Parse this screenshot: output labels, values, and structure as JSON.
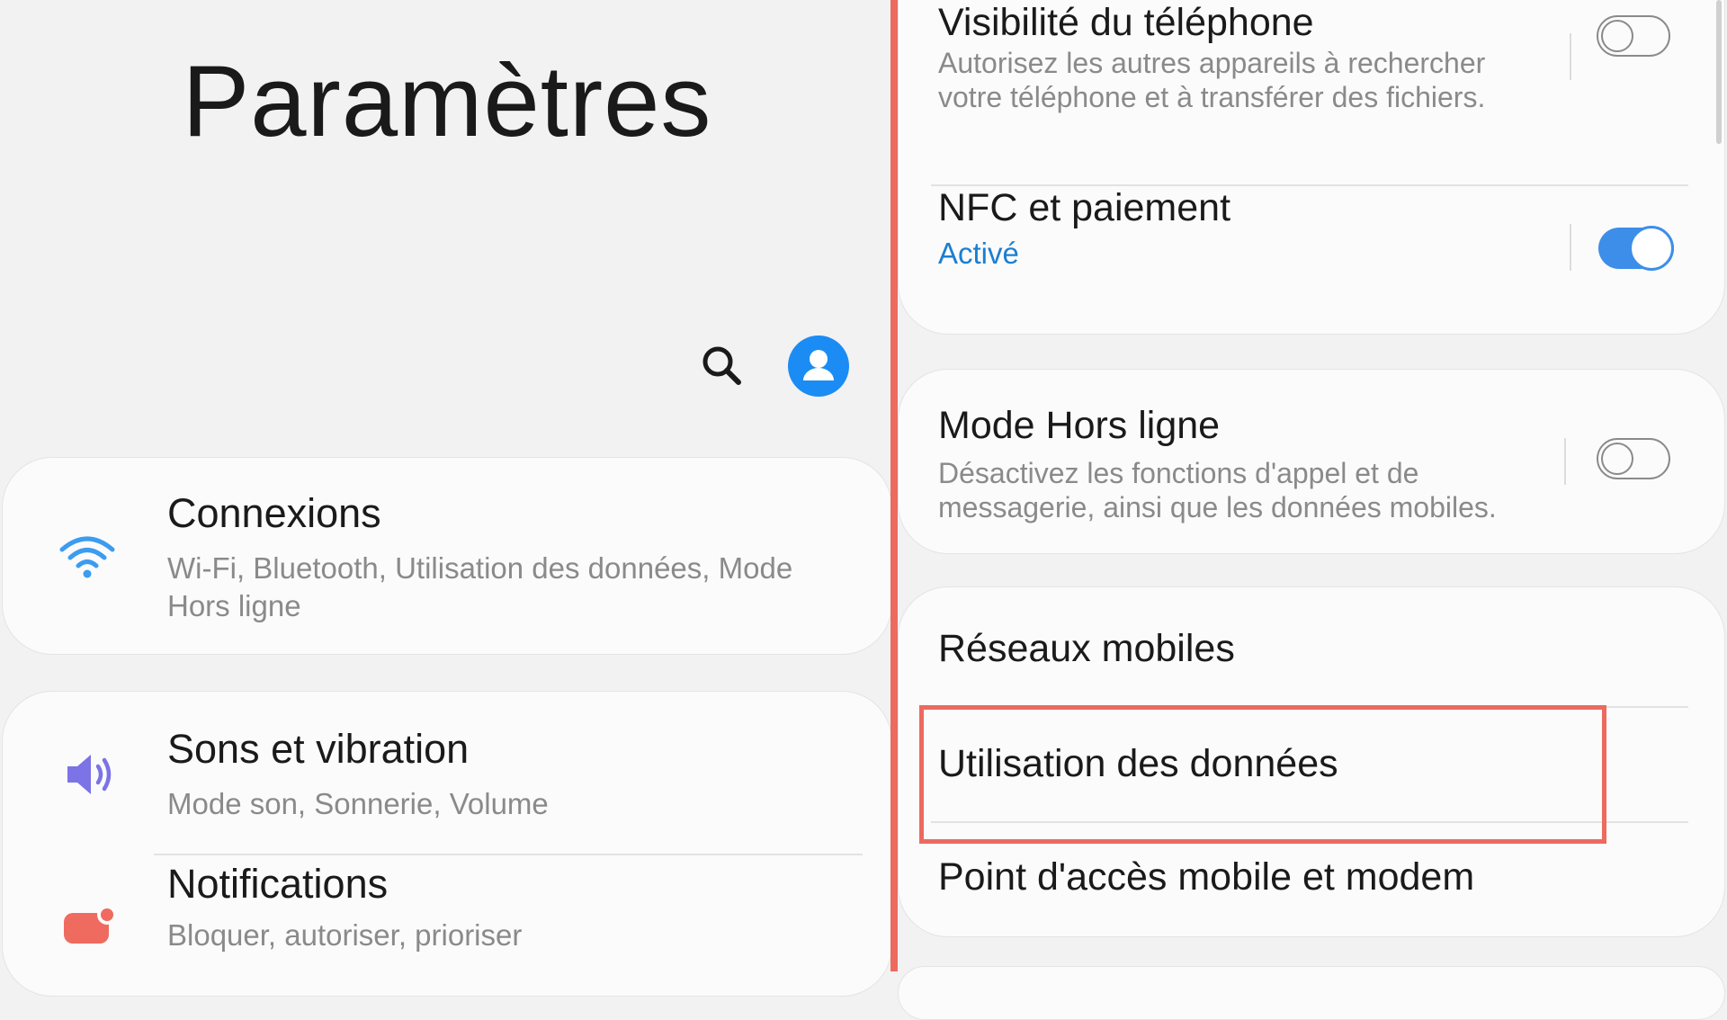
{
  "left": {
    "title": "Paramètres",
    "items": [
      {
        "label": "Connexions",
        "sub": "Wi-Fi, Bluetooth, Utilisation des données, Mode Hors ligne",
        "icon": "wifi-icon"
      },
      {
        "label": "Sons et vibration",
        "sub": "Mode son, Sonnerie, Volume",
        "icon": "speaker-icon"
      },
      {
        "label": "Notifications",
        "sub": "Bloquer, autoriser, prioriser",
        "icon": "notification-icon"
      }
    ]
  },
  "right": {
    "visibility": {
      "label": "Visibilité du téléphone",
      "desc": "Autorisez les autres appareils à rechercher votre téléphone et à transférer des fichiers.",
      "toggle": "off"
    },
    "nfc": {
      "label": "NFC et paiement",
      "status": "Activé",
      "toggle": "on"
    },
    "airplane": {
      "label": "Mode Hors ligne",
      "desc": "Désactivez les fonctions d'appel et de messagerie, ainsi que les données mobiles.",
      "toggle": "off"
    },
    "mobile_networks": "Réseaux mobiles",
    "data_usage": "Utilisation des données",
    "hotspot": "Point d'accès mobile et modem"
  },
  "colors": {
    "accent_blue": "#1b8cf3",
    "highlight_red": "#ec6a5e",
    "wifi_blue": "#3b9cf0",
    "speaker_purple": "#7b73e6",
    "notif_red": "#ef6b60"
  }
}
